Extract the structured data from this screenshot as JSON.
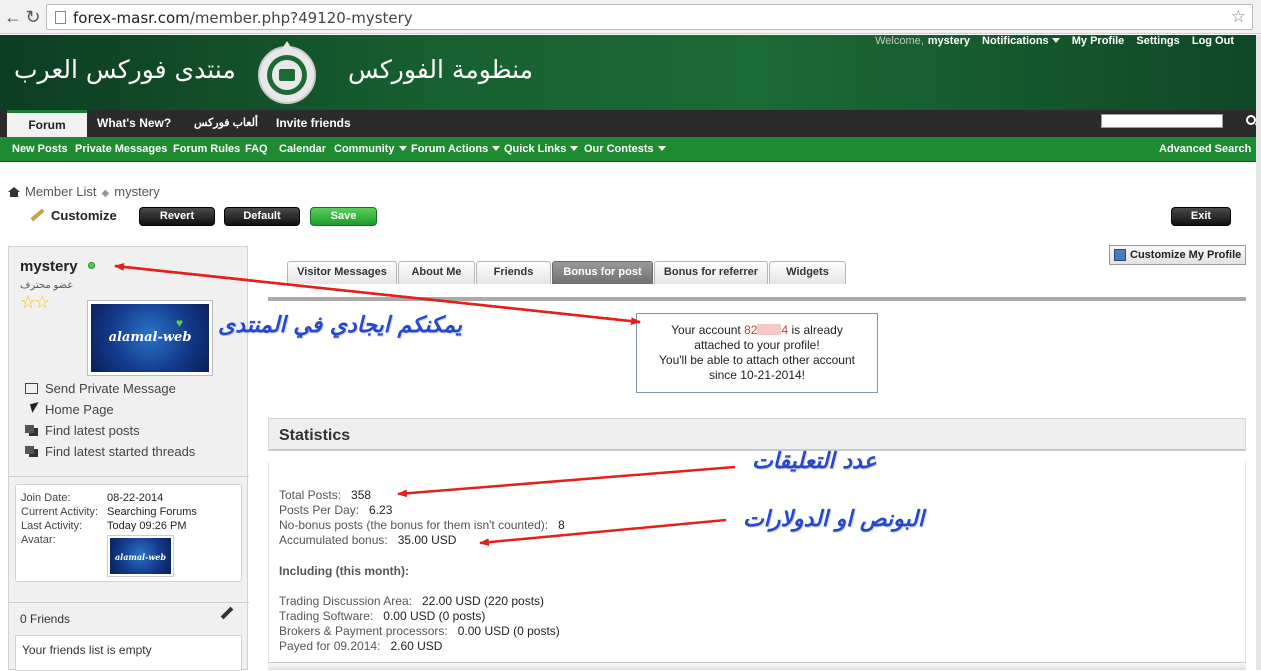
{
  "browser": {
    "url_host": "forex-masr.com",
    "url_path": "/member.php?49120-mystery"
  },
  "header": {
    "title_right": "منتدى فوركس العرب",
    "title_left": "منظومة الفوركس"
  },
  "userbar": {
    "welcome": "Welcome,",
    "username": "mystery",
    "notifications": "Notifications",
    "my_profile": "My Profile",
    "settings": "Settings",
    "logout": "Log Out"
  },
  "navbar": {
    "tabs": [
      "Forum",
      "What's New?",
      "ألعاب فوركس",
      "Invite friends"
    ]
  },
  "subnav": {
    "items": [
      "New Posts",
      "Private Messages",
      "Forum Rules",
      "FAQ",
      "Calendar",
      "Community",
      "Forum Actions",
      "Quick Links",
      "Our Contests"
    ],
    "advanced_search": "Advanced Search"
  },
  "breadcrumb": {
    "member_list": "Member List",
    "current": "mystery"
  },
  "toolbar": {
    "customize": "Customize",
    "revert": "Revert",
    "default": "Default",
    "save": "Save",
    "exit": "Exit"
  },
  "sidebar": {
    "username": "mystery",
    "rank": "عضو محترف",
    "stars": "☆☆",
    "avatar_text": "alamal-web",
    "links": [
      "Send Private Message",
      "Home Page",
      "Find latest posts",
      "Find latest started threads"
    ],
    "info": {
      "join_label": "Join Date:",
      "join_value": "08-22-2014",
      "activity_label": "Current Activity:",
      "activity_value": "Searching Forums",
      "last_label": "Last Activity:",
      "last_value": "Today 09:26 PM",
      "avatar_label": "Avatar:"
    },
    "friends_title": "0 Friends",
    "friends_empty": "Your friends list is empty"
  },
  "main": {
    "customize_profile": "Customize My Profile",
    "tabs": [
      "Visitor Messages",
      "About Me",
      "Friends",
      "Bonus for post",
      "Bonus for referrer",
      "Widgets"
    ],
    "active_tab": "Bonus for post",
    "notice": {
      "line1_pre": "Your account",
      "account_start": "82",
      "account_end": "4",
      "line1_post": "is already",
      "line2": "attached to your profile!",
      "line3": "You'll be able to attach other account",
      "line4": "since 10-21-2014!"
    },
    "statistics": {
      "title": "Statistics",
      "total_posts_label": "Total Posts:",
      "total_posts": "358",
      "ppd_label": "Posts Per Day:",
      "ppd": "6.23",
      "nobonus_label": "No-bonus posts (the bonus for them isn't counted):",
      "nobonus": "8",
      "accum_label": "Accumulated bonus:",
      "accum": "35.00 USD",
      "including": "Including (this month):",
      "rows": [
        {
          "label": "Trading Discussion Area:",
          "value": "22.00 USD (220 posts)"
        },
        {
          "label": "Trading Software:",
          "value": "0.00 USD (0 posts)"
        },
        {
          "label": "Brokers & Payment processors:",
          "value": "0.00 USD (0 posts)"
        },
        {
          "label": "Payed for 09.2014:",
          "value": "2.60 USD"
        }
      ]
    }
  },
  "annotations": {
    "find_user": "يمكنكم ايجادي في المنتدى",
    "comment_count": "عدد التعليقات",
    "bonus": "البونص او الدولارات"
  },
  "colors": {
    "header_green": "#17602f",
    "subnav_green": "#1e8b33",
    "annotation_blue": "#2947c9",
    "arrow_red": "#e3201b"
  }
}
